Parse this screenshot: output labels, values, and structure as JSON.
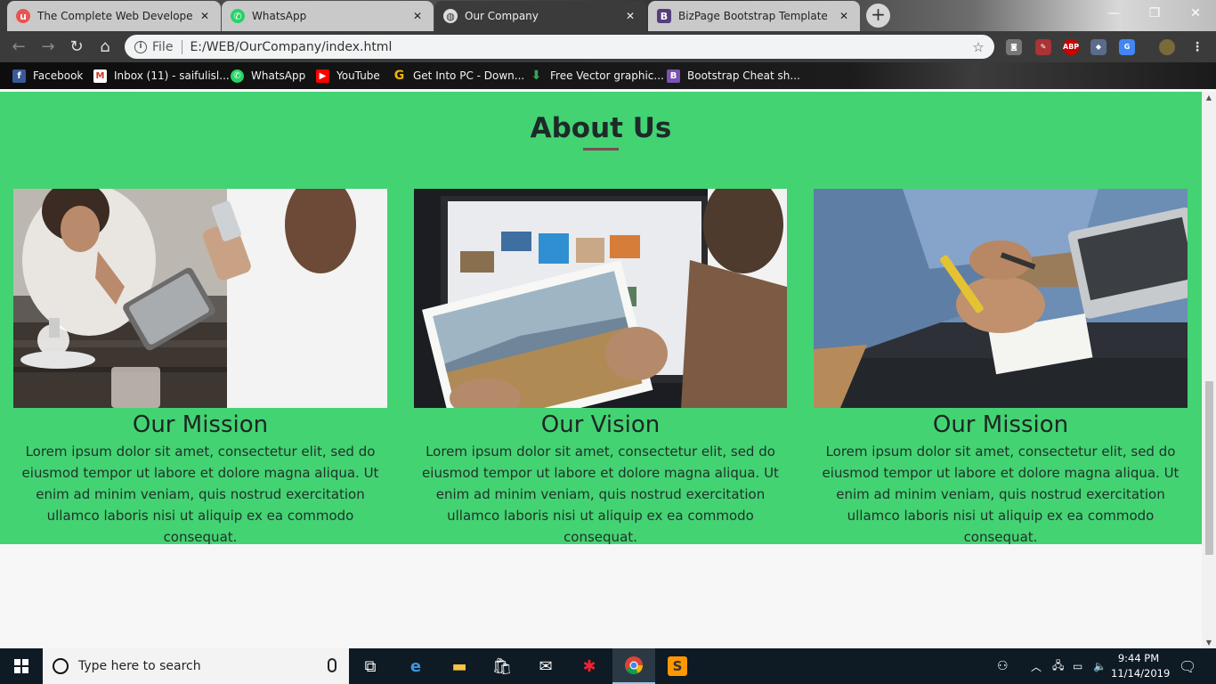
{
  "browser": {
    "tabs": [
      {
        "title": "The Complete Web Developer Co",
        "icon": "udemy-icon",
        "active": false
      },
      {
        "title": "WhatsApp",
        "icon": "whatsapp-icon",
        "active": false
      },
      {
        "title": "Our Company",
        "icon": "globe-icon",
        "active": true
      },
      {
        "title": "BizPage Bootstrap Template",
        "icon": "bootstrap-icon",
        "active": false
      }
    ],
    "address": {
      "scheme_label": "File",
      "url": "E:/WEB/OurCompany/index.html"
    },
    "bookmarks": [
      {
        "label": "Facebook",
        "icon": "facebook-icon",
        "color": "#3b5998"
      },
      {
        "label": "Inbox (11) - saifulisl...",
        "icon": "gmail-icon",
        "color": "#d93025"
      },
      {
        "label": "WhatsApp",
        "icon": "whatsapp-icon",
        "color": "#25d366"
      },
      {
        "label": "YouTube",
        "icon": "youtube-icon",
        "color": "#ff0000"
      },
      {
        "label": "Get Into PC - Down...",
        "icon": "getintopc-icon",
        "color": "#f4b400"
      },
      {
        "label": "Free Vector graphic...",
        "icon": "download-arrow-icon",
        "color": "#34a853"
      },
      {
        "label": "Bootstrap Cheat sh...",
        "icon": "bootstrap-cheat-icon",
        "color": "#7952b3"
      }
    ]
  },
  "page": {
    "section_title": "About Us",
    "accent_color": "#43d373",
    "cards": [
      {
        "heading": "Our Mission",
        "text": "Lorem ipsum dolor sit amet, consectetur elit, sed do eiusmod tempor ut labore et dolore magna aliqua. Ut enim ad minim veniam, quis nostrud exercitation ullamco laboris nisi ut aliquip ex ea commodo consequat.",
        "image": "people-with-tablet-and-phone"
      },
      {
        "heading": "Our Vision",
        "text": "Lorem ipsum dolor sit amet, consectetur elit, sed do eiusmod tempor ut labore et dolore magna aliqua. Ut enim ad minim veniam, quis nostrud exercitation ullamco laboris nisi ut aliquip ex ea commodo consequat.",
        "image": "man-holding-landscape-photo"
      },
      {
        "heading": "Our Mission",
        "text": "Lorem ipsum dolor sit amet, consectetur elit, sed do eiusmod tempor ut labore et dolore magna aliqua. Ut enim ad minim veniam, quis nostrud exercitation ullamco laboris nisi ut aliquip ex ea commodo consequat.",
        "image": "person-writing-near-laptop"
      }
    ]
  },
  "taskbar": {
    "search_placeholder": "Type here to search",
    "time": "9:44 PM",
    "date": "11/14/2019"
  }
}
